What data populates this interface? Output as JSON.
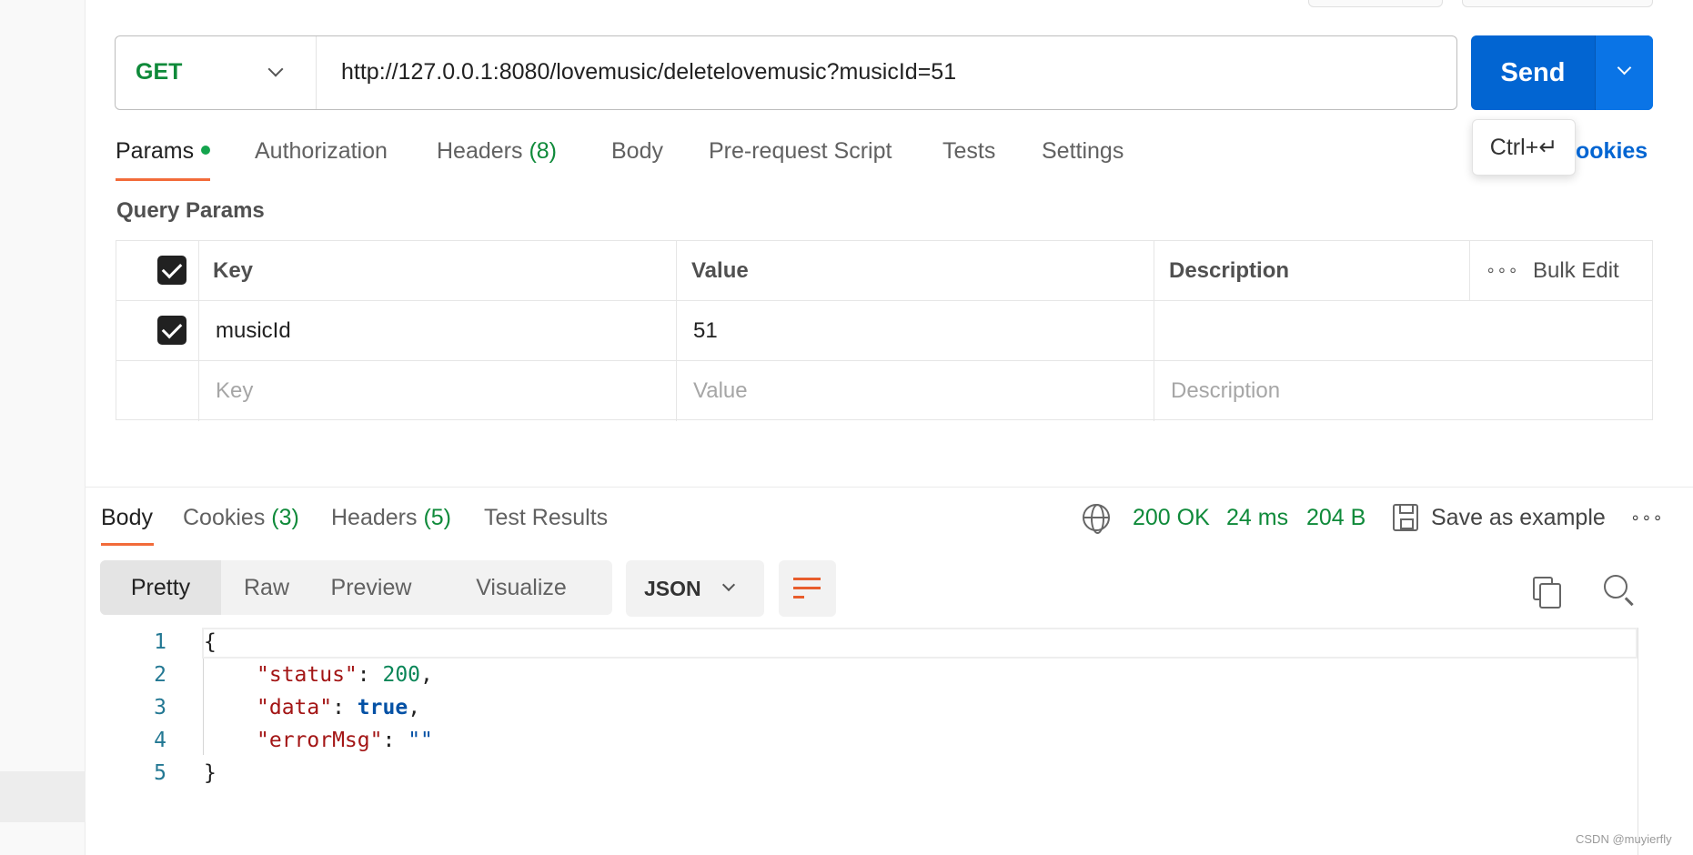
{
  "request": {
    "method": "GET",
    "url": "http://127.0.0.1:8080/lovemusic/deletelovemusic?musicId=51",
    "send_label": "Send",
    "tooltip": "Ctrl+↵",
    "cookies_label": "ookies"
  },
  "request_tabs": {
    "params": "Params",
    "authorization": "Authorization",
    "headers": "Headers",
    "headers_count": "(8)",
    "body": "Body",
    "prerequest": "Pre-request Script",
    "tests": "Tests",
    "settings": "Settings"
  },
  "query_params": {
    "title": "Query Params",
    "headers": {
      "key": "Key",
      "value": "Value",
      "description": "Description",
      "more": "∘∘∘",
      "bulk_edit": "Bulk Edit"
    },
    "rows": [
      {
        "key": "musicId",
        "value": "51",
        "description": ""
      }
    ],
    "placeholders": {
      "key": "Key",
      "value": "Value",
      "description": "Description"
    }
  },
  "response_tabs": {
    "body": "Body",
    "cookies": "Cookies",
    "cookies_count": "(3)",
    "headers": "Headers",
    "headers_count": "(5)",
    "test_results": "Test Results"
  },
  "response_status": {
    "status": "200 OK",
    "time": "24 ms",
    "size": "204 B",
    "save_example": "Save as example",
    "more": "∘∘∘"
  },
  "view_modes": [
    "Pretty",
    "Raw",
    "Preview",
    "Visualize"
  ],
  "format": "JSON",
  "code": {
    "line_numbers": [
      "1",
      "2",
      "3",
      "4",
      "5"
    ],
    "open_brace": "{",
    "close_brace": "}",
    "status_key": "\"status\"",
    "status_value": "200",
    "data_key": "\"data\"",
    "data_value": "true",
    "error_key": "\"errorMsg\"",
    "error_value": "\"\""
  },
  "watermark": "CSDN @muyierfly",
  "colors": {
    "accent": "#0265d2",
    "success": "#0f8a3a",
    "tab_underline": "#f26b3a"
  }
}
